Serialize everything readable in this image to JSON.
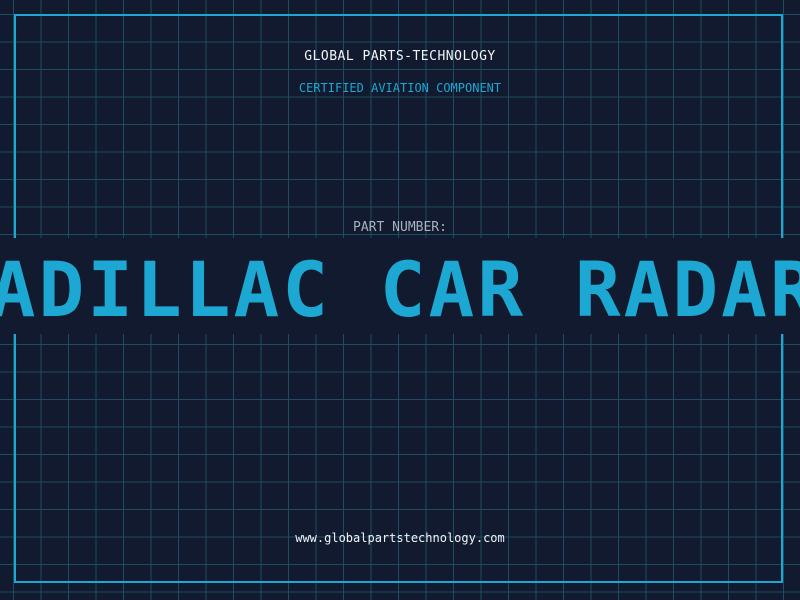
{
  "header": {
    "company": "GLOBAL PARTS-TECHNOLOGY",
    "certification": "CERTIFIED AVIATION COMPONENT"
  },
  "part": {
    "label": "PART NUMBER:",
    "value": "CADILLAC CAR RADAR SYSTEM"
  },
  "footer": {
    "website": "www.globalpartstechnology.com"
  },
  "colors": {
    "background": "#111a2e",
    "grid": "#1d4c63",
    "accent": "#1ca8d2",
    "text": "#f2f4f8"
  }
}
